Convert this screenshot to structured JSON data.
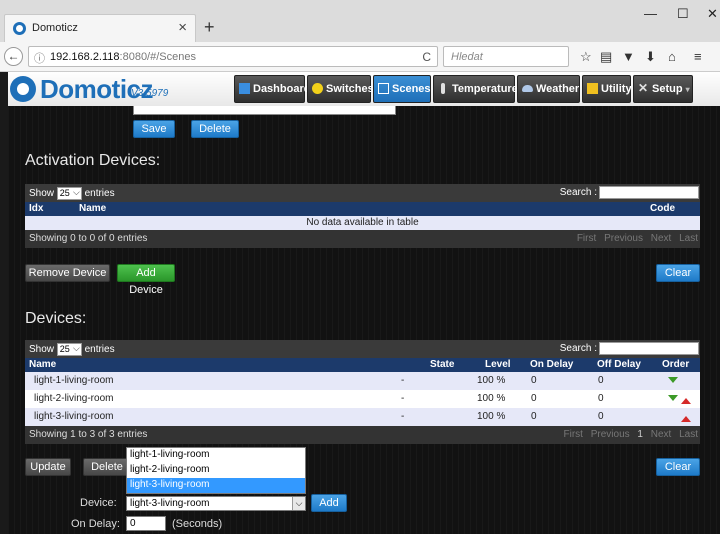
{
  "browser": {
    "tab_title": "Domoticz",
    "tab_close": "×",
    "new_tab": "+",
    "url_info": "ⓘ",
    "url_host": "192.168.2.118",
    "url_path": ":8080/#/Scenes",
    "reload": "C",
    "search_placeholder": "Hledat",
    "search_icon": "🔍",
    "win_min": "—",
    "win_max": "☐",
    "win_close": "✕",
    "icons": {
      "bookmark": "☆",
      "reader": "▤",
      "pocket": "▼",
      "download": "⬇",
      "home": "⌂",
      "menu": "≡"
    }
  },
  "app": {
    "logo": "Domoticz",
    "version": "V3.5979",
    "menu": [
      {
        "label": "Dashboard",
        "active": false,
        "icon": "dashboard-icon",
        "color": "#3a8ee0"
      },
      {
        "label": "Switches",
        "active": false,
        "icon": "bulb-icon",
        "color": "#f2d11a"
      },
      {
        "label": "Scenes",
        "active": true,
        "icon": "scenes-icon",
        "color": "#ffffff"
      },
      {
        "label": "Temperature",
        "active": false,
        "icon": "thermometer-icon",
        "color": "#e0e0e0"
      },
      {
        "label": "Weather",
        "active": false,
        "icon": "cloud-icon",
        "color": "#b0c8e8"
      },
      {
        "label": "Utility",
        "active": false,
        "icon": "utility-icon",
        "color": "#f0c020"
      },
      {
        "label": "Setup",
        "active": false,
        "icon": "tools-icon",
        "color": "#e0e0e0"
      }
    ]
  },
  "top_buttons": {
    "save": "Save",
    "delete": "Delete"
  },
  "activation": {
    "title": "Activation Devices:",
    "show": "Show",
    "entries_value": "25",
    "entries": "entries",
    "search_label": "Search :",
    "columns": {
      "idx": "Idx",
      "name": "Name",
      "code": "Code"
    },
    "empty_text": "No data available in table",
    "info": "Showing 0 to 0 of 0 entries",
    "pager": {
      "first": "First",
      "previous": "Previous",
      "next": "Next",
      "last": "Last"
    },
    "remove_button": "Remove Device",
    "add_button": "Add Device",
    "clear_button": "Clear"
  },
  "devices": {
    "title": "Devices:",
    "show": "Show",
    "entries_value": "25",
    "entries": "entries",
    "search_label": "Search :",
    "columns": {
      "name": "Name",
      "state": "State",
      "level": "Level",
      "on_delay": "On Delay",
      "off_delay": "Off Delay",
      "order": "Order"
    },
    "rows": [
      {
        "name": "light-1-living-room",
        "state": "-",
        "level": "100 %",
        "on_delay": "0",
        "off_delay": "0"
      },
      {
        "name": "light-2-living-room",
        "state": "-",
        "level": "100 %",
        "on_delay": "0",
        "off_delay": "0"
      },
      {
        "name": "light-3-living-room",
        "state": "-",
        "level": "100 %",
        "on_delay": "0",
        "off_delay": "0"
      }
    ],
    "info": "Showing 1 to 3 of 3 entries",
    "pager": {
      "first": "First",
      "previous": "Previous",
      "page": "1",
      "next": "Next",
      "last": "Last"
    },
    "update_button": "Update",
    "delete_button": "Delete",
    "clear_button": "Clear"
  },
  "form": {
    "device_label": "Device:",
    "device_value": "light-3-living-room",
    "device_options": [
      "light-1-living-room",
      "light-2-living-room",
      "light-3-living-room"
    ],
    "add_button": "Add",
    "on_delay_label": "On Delay:",
    "on_delay_value": "0",
    "seconds_label": "(Seconds)"
  }
}
